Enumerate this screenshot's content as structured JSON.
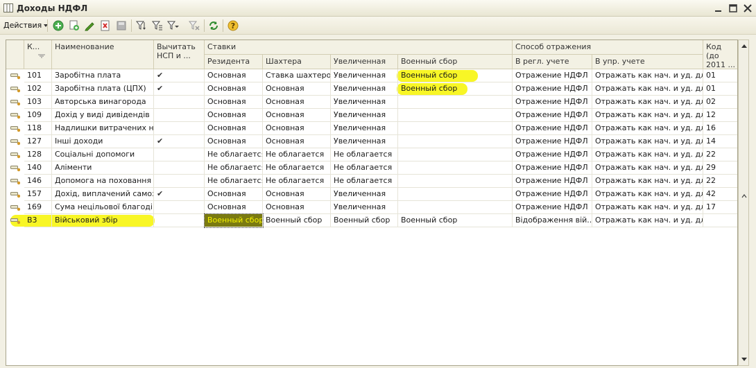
{
  "window": {
    "title": "Доходы НДФЛ"
  },
  "toolbar": {
    "actions_label": "Действия"
  },
  "columns": {
    "code": "К...",
    "name": "Наименование",
    "deduct": "Вычитать НСП и ...",
    "rates_group": "Ставки",
    "resident": "Резидента",
    "miners": "Шахтера",
    "increased": "Увеличенная",
    "military": "Военный сбор",
    "reflection_group": "Способ отражения",
    "regl": "В регл. учете",
    "upr": "В упр. учете",
    "oldcode": "Код (до 2011 ..."
  },
  "rows": [
    {
      "code": "101",
      "name": "Заробітна плата",
      "deduct": "✔",
      "resident": "Основная",
      "miners": "Ставка шахтеров",
      "increased": "Увеличенная",
      "military": "Военный сбор",
      "regl": "Отражение НДФЛ",
      "upr": "Отражать как нач. и уд. для...",
      "oldcode": "01"
    },
    {
      "code": "102",
      "name": "Заробітна плата (ЦПХ)",
      "deduct": "✔",
      "resident": "Основная",
      "miners": "Основная",
      "increased": "Увеличенная",
      "military": "Военный сбор",
      "regl": "Отражение НДФЛ",
      "upr": "Отражать как нач. и уд. для...",
      "oldcode": "01"
    },
    {
      "code": "103",
      "name": "Авторська винагорода",
      "deduct": "",
      "resident": "Основная",
      "miners": "Основная",
      "increased": "Увеличенная",
      "military": "",
      "regl": "Отражение НДФЛ",
      "upr": "Отражать как нач. и уд. для...",
      "oldcode": "02"
    },
    {
      "code": "109",
      "name": "Дохід у виді дивідендів",
      "deduct": "",
      "resident": "Основная",
      "miners": "Основная",
      "increased": "Увеличенная",
      "military": "",
      "regl": "Отражение НДФЛ",
      "upr": "Отражать как нач. и уд. для...",
      "oldcode": "12"
    },
    {
      "code": "118",
      "name": "Надлишки витрачених на...",
      "deduct": "",
      "resident": "Основная",
      "miners": "Основная",
      "increased": "Увеличенная",
      "military": "",
      "regl": "Отражение НДФЛ",
      "upr": "Отражать как нач. и уд. для...",
      "oldcode": "16"
    },
    {
      "code": "127",
      "name": "Інші доходи",
      "deduct": "✔",
      "resident": "Основная",
      "miners": "Основная",
      "increased": "Увеличенная",
      "military": "",
      "regl": "Отражение НДФЛ",
      "upr": "Отражать как нач. и уд. для...",
      "oldcode": "14"
    },
    {
      "code": "128",
      "name": "Соціальні допомоги",
      "deduct": "",
      "resident": "Не облагается",
      "miners": "Не облагается",
      "increased": "Не облагается",
      "military": "",
      "regl": "Отражение НДФЛ",
      "upr": "Отражать как нач. и уд. для...",
      "oldcode": "22"
    },
    {
      "code": "140",
      "name": "Аліменти",
      "deduct": "",
      "resident": "Не облагается",
      "miners": "Не облагается",
      "increased": "Не облагается",
      "military": "",
      "regl": "Отражение НДФЛ",
      "upr": "Отражать как нач. и уд. для...",
      "oldcode": "29"
    },
    {
      "code": "146",
      "name": "Допомога на поховання",
      "deduct": "",
      "resident": "Не облагается",
      "miners": "Не облагается",
      "increased": "Не облагается",
      "military": "",
      "regl": "Отражение НДФЛ",
      "upr": "Отражать как нач. и уд. для...",
      "oldcode": "22"
    },
    {
      "code": "157",
      "name": "Дохід, виплачений самоз...",
      "deduct": "✔",
      "resident": "Основная",
      "miners": "Основная",
      "increased": "Увеличенная",
      "military": "",
      "regl": "Отражение НДФЛ",
      "upr": "Отражать как нач. и уд. для...",
      "oldcode": "42"
    },
    {
      "code": "169",
      "name": "Сума нецільової благодій...",
      "deduct": "",
      "resident": "Основная",
      "miners": "Основная",
      "increased": "Увеличенная",
      "military": "",
      "regl": "Отражение НДФЛ",
      "upr": "Отражать как нач. и уд. для...",
      "oldcode": "17"
    },
    {
      "code": "В3",
      "name": "Військовий збір",
      "deduct": "",
      "resident": "Военный сбор",
      "miners": "Военный сбор",
      "increased": "Военный сбор",
      "military": "Военный сбор",
      "regl": "Відображення вій...",
      "upr": "Отражать как нач. и уд. для...",
      "oldcode": ""
    }
  ],
  "colors": {
    "highlight": "#f7f400",
    "header_bg": "#f3f1e4",
    "selected_cell": "#7a7a10"
  }
}
